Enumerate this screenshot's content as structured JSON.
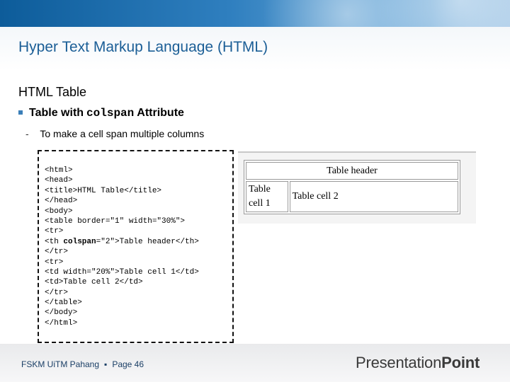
{
  "slide": {
    "title": "Hyper Text Markup Language (HTML)",
    "section_heading": "HTML Table",
    "bullet": {
      "prefix": "Table with",
      "code_word": "colspan",
      "suffix": "Attribute"
    },
    "sub_bullet": {
      "dash": "-",
      "text": "To make a cell span multiple columns"
    }
  },
  "code_lines": [
    "<html>",
    "<head>",
    "<title>HTML Table</title>",
    "</head>",
    "<body>",
    "<table border=\"1\" width=\"30%\">",
    "<tr>",
    "<th colspan=\"2\">Table header</th>",
    "</tr>",
    "<tr>",
    "<td width=\"20%\">Table cell 1</td>",
    "<td>Table cell 2</td>",
    "</tr>",
    "</table>",
    "</body>",
    "</html>"
  ],
  "preview_table": {
    "header": "Table header",
    "cell_1": "Table cell 1",
    "cell_2": "Table cell 2"
  },
  "footer": {
    "org": "FSKM UiTM Pahang",
    "separator": "▪",
    "page_label": "Page 46",
    "brand_part1": "Presentation",
    "brand_part2": "Point"
  },
  "colors": {
    "title_blue": "#1b5e96",
    "bullet_blue": "#3b7fb8"
  }
}
